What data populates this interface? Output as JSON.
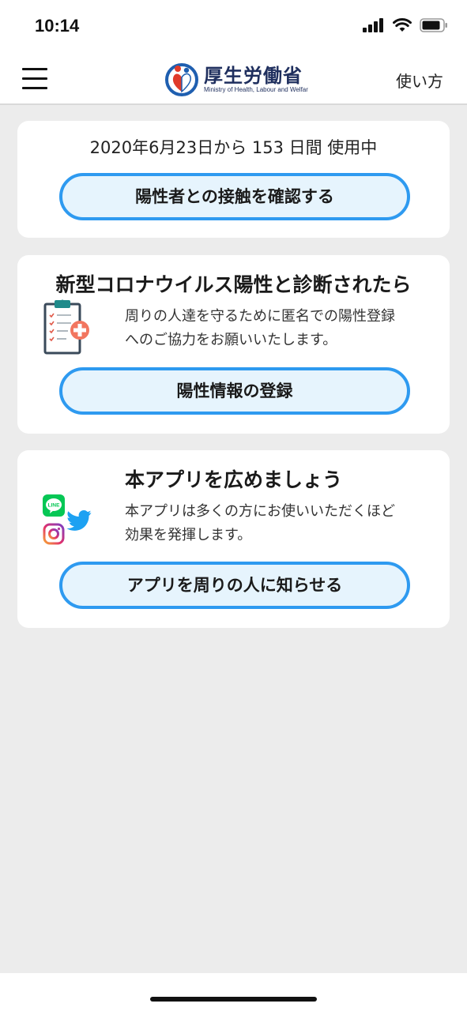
{
  "status_bar": {
    "time": "10:14"
  },
  "navbar": {
    "logo_text": "厚生労働省",
    "logo_subtext": "Ministry of Health, Labour and Welfar",
    "howto_label": "使い方"
  },
  "usage_card": {
    "usage_text": "2020年6月23日から 153 日間 使用中",
    "check_button_label": "陽性者との接触を確認する"
  },
  "register_card": {
    "title": "新型コロナウイルス陽性と診断されたら",
    "body_line1": "周りの人達を守るために匿名での陽性登録",
    "body_line2": "へのご協力をお願いいたします。",
    "register_button_label": "陽性情報の登録"
  },
  "share_card": {
    "title": "本アプリを広めましょう",
    "body_line1": "本アプリは多くの方にお使いいただくほど",
    "body_line2": "効果を発揮します。",
    "share_button_label": "アプリを周りの人に知らせる",
    "line_badge": "LINE"
  },
  "colors": {
    "button_border": "#2e9af0",
    "button_fill": "#e6f4fd",
    "background": "#ececec",
    "line_green": "#06c755",
    "twitter_blue": "#1da1f2"
  }
}
